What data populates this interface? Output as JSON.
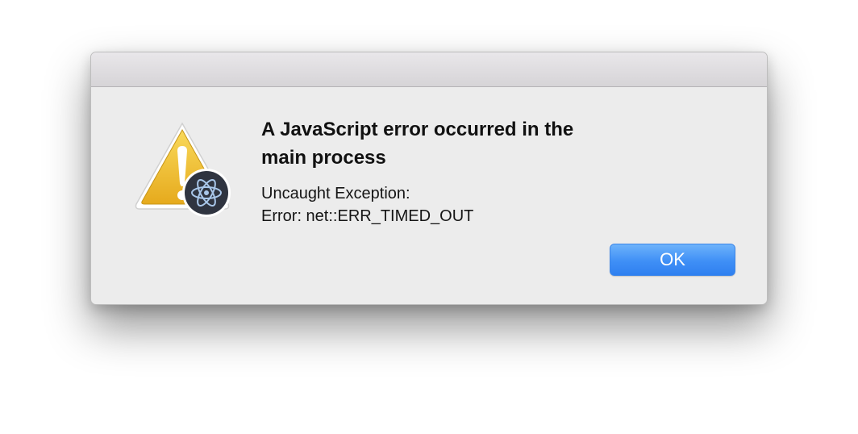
{
  "dialog": {
    "title": "A JavaScript error occurred in the\nmain process",
    "message": "Uncaught Exception:\nError: net::ERR_TIMED_OUT",
    "ok_label": "OK",
    "icon": "warning-triangle-with-electron-badge"
  },
  "colors": {
    "dialog_background": "#ececec",
    "titlebar": "#dddcdf",
    "button_accent": "#3f8ff6",
    "warning_yellow": "#f2c12e",
    "badge_dark": "#2f3440"
  }
}
